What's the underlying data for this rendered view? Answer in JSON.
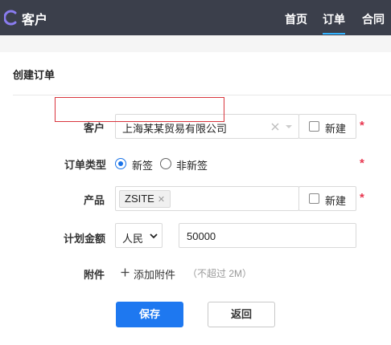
{
  "app": {
    "title": "客户"
  },
  "nav": [
    {
      "label": "首页",
      "active": false
    },
    {
      "label": "订单",
      "active": true
    },
    {
      "label": "合同",
      "active": false
    }
  ],
  "form": {
    "title": "创建订单",
    "customer": {
      "label": "客户",
      "value": "上海某某贸易有限公司",
      "new_label": "新建",
      "new_checked": false,
      "required": "*"
    },
    "order_type": {
      "label": "订单类型",
      "options": [
        "新签",
        "非新签"
      ],
      "selected": "新签",
      "required": "*"
    },
    "product": {
      "label": "产品",
      "tags": [
        "ZSITE"
      ],
      "new_label": "新建",
      "new_checked": false,
      "required": "*"
    },
    "amount": {
      "label": "计划金额",
      "currency": "人民",
      "value": "50000"
    },
    "attachment": {
      "label": "附件",
      "add_label": "添加附件",
      "hint": "（不超过 2M）"
    }
  },
  "buttons": {
    "save": "保存",
    "back": "返回"
  },
  "colors": {
    "topbar": "#3b3f4b",
    "primary": "#1e78f0",
    "required": "#e8364f",
    "highlight_frame": "#d9363e",
    "logo": "#8a7cf0"
  }
}
